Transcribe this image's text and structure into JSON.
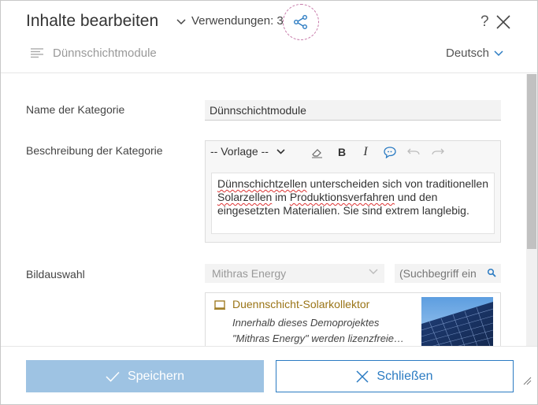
{
  "header": {
    "title": "Inhalte bearbeiten",
    "usage_label": "Verwendungen: 3",
    "help": "?",
    "subtitle": "Dünnschichtmodule",
    "language": "Deutsch"
  },
  "form": {
    "name_label": "Name der Kategorie",
    "name_value": "Dünnschichtmodule",
    "description_label": "Beschreibung der Kategorie",
    "template_select": "-- Vorlage --",
    "bold": "B",
    "italic": "I",
    "description_parts": {
      "p1": "Dünnschichtzellen",
      "p2": " unterscheiden sich von traditionellen ",
      "p3": "Solarzellen",
      "p4": " im ",
      "p5": "Produktionsverfahren",
      "p6": " und den eingesetzten Materialien. Sie sind extrem langlebig."
    },
    "image_label": "Bildauswahl",
    "image_source": "Mithras Energy",
    "search_placeholder": "(Suchbegriff ein",
    "result": {
      "title": "Duennschicht-Solarkollektor",
      "desc_line1": "Innerhalb dieses Demoprojektes",
      "desc_line2": "\"Mithras Energy\" werden lizenzfreie…"
    }
  },
  "footer": {
    "save_label": "Speichern",
    "close_label": "Schließen"
  },
  "colors": {
    "accent": "#2b7bc2",
    "save_disabled": "#9ec3e3",
    "result_title": "#9a7416"
  }
}
